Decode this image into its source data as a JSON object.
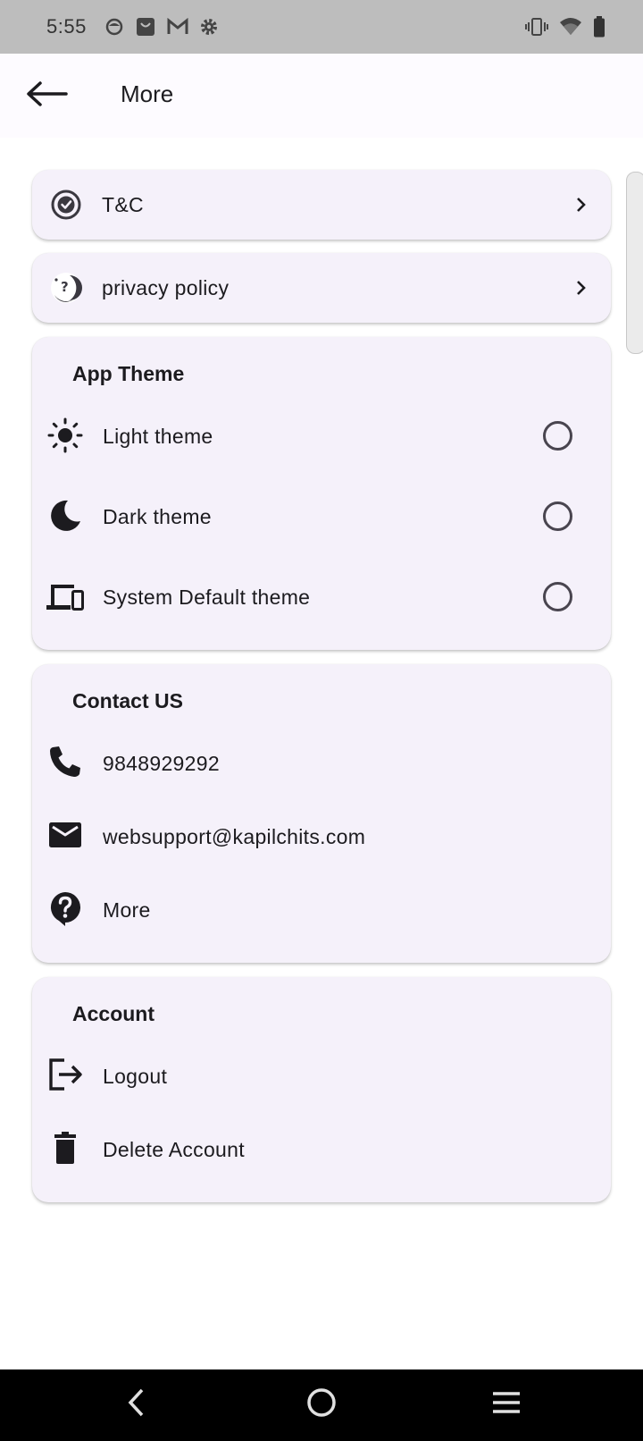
{
  "status_bar": {
    "time": "5:55",
    "left_icons": [
      "app-circle-icon",
      "shopping-bag-icon",
      "gmail-icon",
      "settings-gear-icon"
    ],
    "right_icons": [
      "vibrate-icon",
      "wifi-icon",
      "battery-icon"
    ]
  },
  "app_bar": {
    "title": "More",
    "back_icon": "arrow-back-icon"
  },
  "links": [
    {
      "label": "T&C",
      "icon": "verified-shield-icon"
    },
    {
      "label": "privacy policy",
      "icon": "privacy-question-icon"
    }
  ],
  "app_theme": {
    "title": "App Theme",
    "options": [
      {
        "label": "Light theme",
        "icon": "sun-icon",
        "selected": false
      },
      {
        "label": "Dark theme",
        "icon": "moon-icon",
        "selected": false
      },
      {
        "label": "System Default theme",
        "icon": "devices-icon",
        "selected": false
      }
    ]
  },
  "contact": {
    "title": "Contact US",
    "items": [
      {
        "label": "9848929292",
        "icon": "phone-icon"
      },
      {
        "label": "websupport@kapilchits.com",
        "icon": "mail-icon"
      },
      {
        "label": "More",
        "icon": "help-icon"
      }
    ]
  },
  "account": {
    "title": "Account",
    "items": [
      {
        "label": "Logout",
        "icon": "logout-icon"
      },
      {
        "label": "Delete Account",
        "icon": "delete-icon"
      }
    ]
  },
  "colors": {
    "card_background": "#f5f1fa",
    "status_bar": "#bdbdbd",
    "nav_bar": "#000000",
    "text": "#1c1b1f"
  }
}
